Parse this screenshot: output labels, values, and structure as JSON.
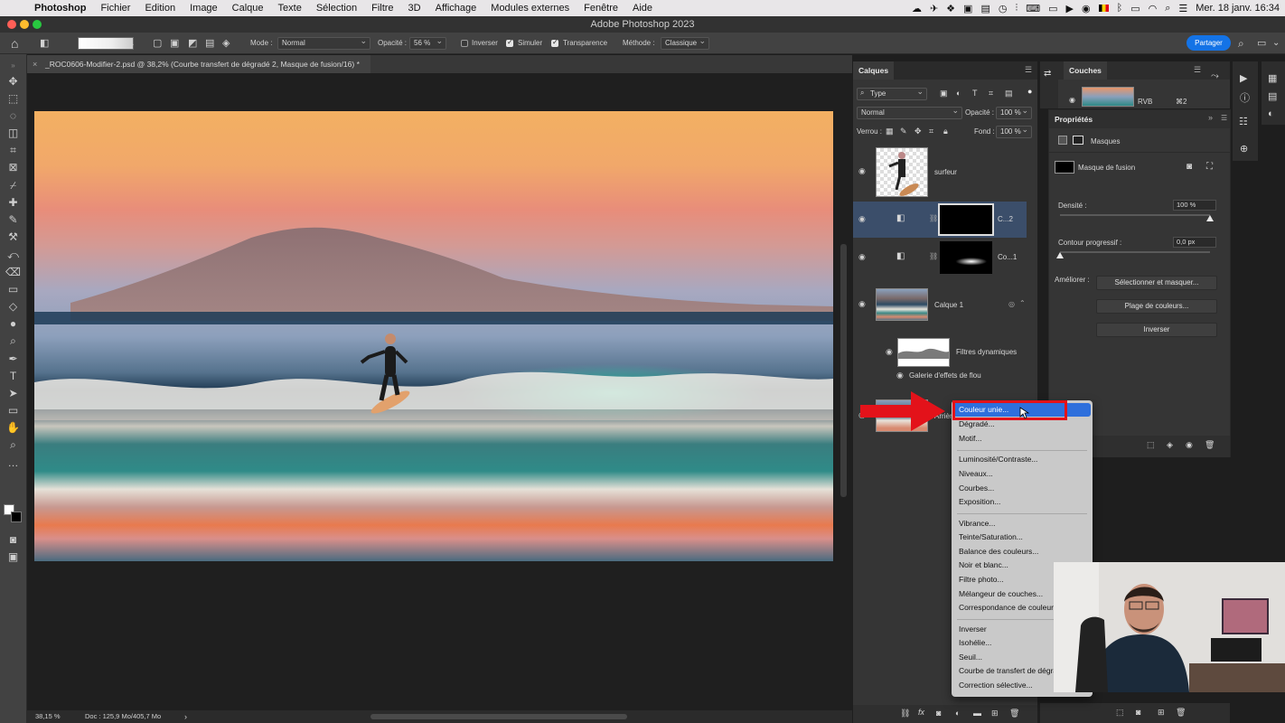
{
  "menubar": {
    "app": "Photoshop",
    "items": [
      "Fichier",
      "Edition",
      "Image",
      "Calque",
      "Texte",
      "Sélection",
      "Filtre",
      "3D",
      "Affichage",
      "Modules externes",
      "Fenêtre",
      "Aide"
    ],
    "clock": "Mer. 18 janv.  16:34"
  },
  "window_title": "Adobe Photoshop 2023",
  "options": {
    "mode_label": "Mode :",
    "mode_value": "Normal",
    "opacity_label": "Opacité :",
    "opacity_value": "56 %",
    "reverse_label": "Inverser",
    "simulate_label": "Simuler",
    "transparency_label": "Transparence",
    "method_label": "Méthode :",
    "method_value": "Classique",
    "share_label": "Partager"
  },
  "document": {
    "tab_title": "_ROC0606-Modifier-2.psd @ 38,2% (Courbe transfert de dégradé 2, Masque de fusion/16) *",
    "zoom": "38,15 %",
    "doc_info": "Doc : 125,9 Mo/405,7 Mo"
  },
  "layers_panel": {
    "tab": "Calques",
    "filter_value": "Type",
    "blend_value": "Normal",
    "opacity_label": "Opacité :",
    "opacity_value": "100 %",
    "lock_label": "Verrou :",
    "fill_label": "Fond :",
    "fill_value": "100 %",
    "layers": [
      {
        "name": "surfeur"
      },
      {
        "name": "C...2"
      },
      {
        "name": "Co...1"
      },
      {
        "name": "Calque 1"
      },
      {
        "name": "Filtres dynamiques"
      },
      {
        "name": "Galerie d'effets de flou"
      },
      {
        "name": "Arrière..."
      }
    ]
  },
  "channels_panel": {
    "tab": "Couches",
    "row_name": "RVB",
    "row_shortcut": "⌘2"
  },
  "properties_panel": {
    "title": "Propriétés",
    "section": "Masques",
    "mask_name": "Masque de fusion",
    "density_label": "Densité :",
    "density_value": "100 %",
    "density_fraction": 1.0,
    "feather_label": "Contour progressif :",
    "feather_value": "0,0 px",
    "feather_fraction": 0.0,
    "refine_label": "Améliorer :",
    "buttons": [
      "Sélectionner et masquer...",
      "Plage de couleurs...",
      "Inverser"
    ]
  },
  "context_menu": {
    "groups": [
      [
        "Couleur unie...",
        "Dégradé...",
        "Motif..."
      ],
      [
        "Luminosité/Contraste...",
        "Niveaux...",
        "Courbes...",
        "Exposition..."
      ],
      [
        "Vibrance...",
        "Teinte/Saturation...",
        "Balance des couleurs...",
        "Noir et blanc...",
        "Filtre photo...",
        "Mélangeur de couches...",
        "Correspondance de couleur..."
      ],
      [
        "Inverser",
        "Isohélie...",
        "Seuil...",
        "Courbe de transfert de dégradé...",
        "Correction sélective..."
      ]
    ],
    "active_item": "Couleur unie..."
  },
  "colors": {
    "accent": "#1473e6",
    "menu_highlight": "#2e6fdc",
    "annotation_red": "#e3121a",
    "panel_bg": "#353535"
  }
}
